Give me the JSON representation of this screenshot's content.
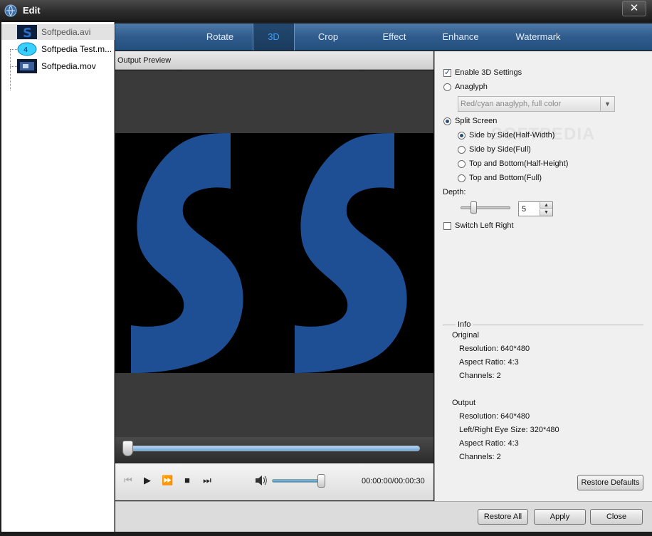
{
  "window": {
    "title": "Edit",
    "close_glyph": "✕"
  },
  "files": [
    {
      "name": "Softpedia.avi",
      "selected": true,
      "thumb_icon": "video-s-thumb-icon"
    },
    {
      "name": "Softpedia Test.m...",
      "selected": false,
      "thumb_icon": "disc-thumb-icon"
    },
    {
      "name": "Softpedia.mov",
      "selected": false,
      "thumb_icon": "video-thumb-icon"
    }
  ],
  "tabs": [
    {
      "label": "Rotate",
      "active": false
    },
    {
      "label": "3D",
      "active": true
    },
    {
      "label": "Crop",
      "active": false
    },
    {
      "label": "Effect",
      "active": false
    },
    {
      "label": "Enhance",
      "active": false
    },
    {
      "label": "Watermark",
      "active": false
    }
  ],
  "preview": {
    "title": "Output Preview",
    "time": "00:00:00/00:00:30",
    "seek_position": 0.0,
    "volume_level": 0.9
  },
  "settings": {
    "enable_3d": {
      "label": "Enable 3D Settings",
      "checked": true
    },
    "anaglyph": {
      "label": "Anaglyph",
      "checked": false
    },
    "anaglyph_mode": {
      "value": "Red/cyan anaglyph, full color"
    },
    "split_screen": {
      "label": "Split Screen",
      "checked": true
    },
    "split_options": [
      {
        "label": "Side by Side(Half-Width)",
        "checked": true
      },
      {
        "label": "Side by Side(Full)",
        "checked": false
      },
      {
        "label": "Top and Bottom(Half-Height)",
        "checked": false
      },
      {
        "label": "Top and Bottom(Full)",
        "checked": false
      }
    ],
    "depth": {
      "label": "Depth:",
      "value": "5",
      "slider_level": 0.25
    },
    "switch_left_right": {
      "label": "Switch Left Right",
      "checked": false
    },
    "watermark_text": "SOFTPEDIA"
  },
  "info": {
    "legend": "Info",
    "original": {
      "heading": "Original",
      "resolution": "Resolution: 640*480",
      "aspect_ratio": "Aspect Ratio: 4:3",
      "channels": "Channels: 2"
    },
    "output": {
      "heading": "Output",
      "resolution": "Resolution: 640*480",
      "eye_size": "Left/Right Eye Size: 320*480",
      "aspect_ratio": "Aspect Ratio: 4:3",
      "channels": "Channels: 2"
    }
  },
  "buttons": {
    "restore_defaults": "Restore Defaults",
    "restore_all": "Restore All",
    "apply": "Apply",
    "close": "Close"
  },
  "colors": {
    "tab_bar": "#2f5c8d",
    "tab_active_text": "#3aa0ff",
    "logo_blue": "#1e4f95"
  }
}
